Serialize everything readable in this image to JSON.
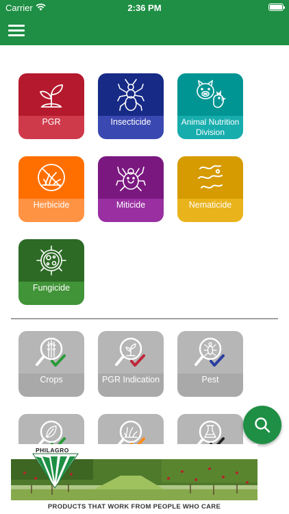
{
  "status_bar": {
    "carrier": "Carrier",
    "time": "2:36 PM"
  },
  "nav": {
    "menu_icon": "hamburger-menu-icon"
  },
  "categories": [
    {
      "label": "PGR",
      "icon": "seedling-icon"
    },
    {
      "label": "Insecticide",
      "icon": "insect-icon"
    },
    {
      "label": "Animal Nutrition Division",
      "icon": "pig-chicken-icon"
    },
    {
      "label": "Herbicide",
      "icon": "no-weed-icon"
    },
    {
      "label": "Miticide",
      "icon": "mite-icon"
    },
    {
      "label": "Nematicide",
      "icon": "nematode-icon"
    },
    {
      "label": "Fungicide",
      "icon": "fungus-icon"
    }
  ],
  "search_tiles": [
    {
      "label": "Crops",
      "icon": "search-crops-icon",
      "check_color": "#2a9a38"
    },
    {
      "label": "PGR Indication",
      "icon": "search-pgr-icon",
      "check_color": "#c0273a"
    },
    {
      "label": "Pest",
      "icon": "search-pest-icon",
      "check_color": "#2a3ea0"
    },
    {
      "label": "",
      "icon": "search-disease-icon",
      "check_color": "#2a9a38"
    },
    {
      "label": "",
      "icon": "search-weed-icon",
      "check_color": "#ff8c1a"
    },
    {
      "label": "",
      "icon": "search-lab-icon",
      "check_color": "#222222"
    }
  ],
  "fab": {
    "icon": "search-icon"
  },
  "banner": {
    "brand": "PHILAGRO",
    "tagline": "PRODUCTS THAT WORK FROM PEOPLE WHO CARE"
  }
}
